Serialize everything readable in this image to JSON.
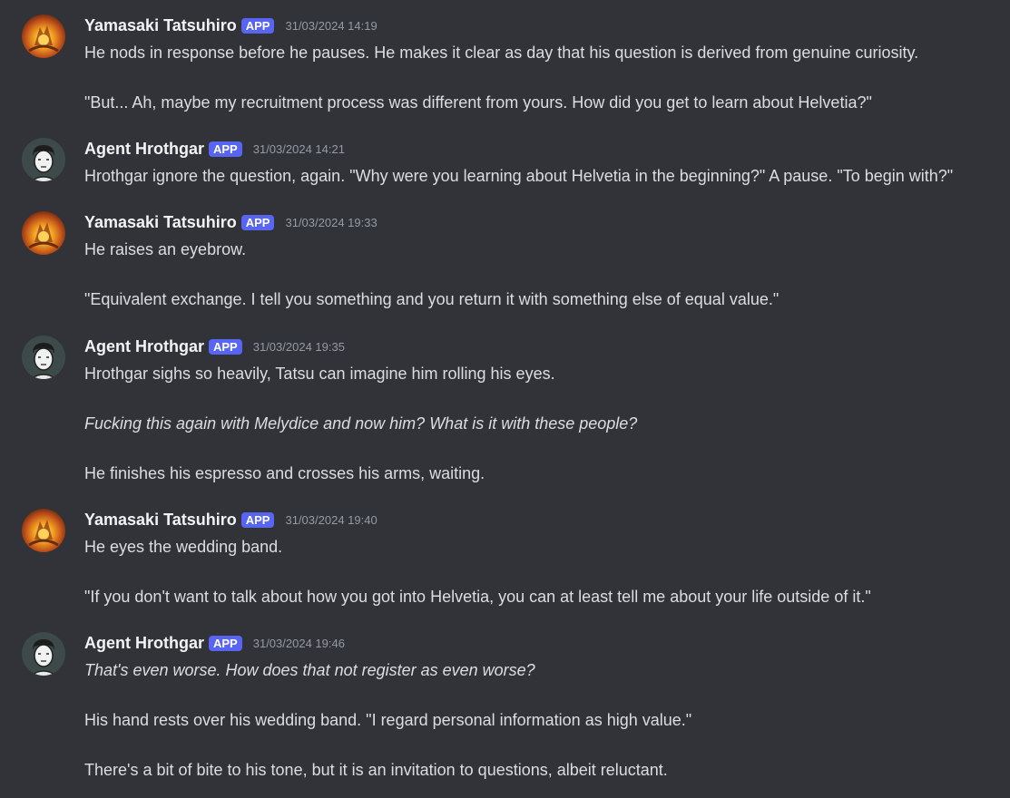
{
  "badge_label": "APP",
  "colors": {
    "background": "#313338",
    "text": "#dbdee1",
    "author": "#f2f3f5",
    "badge": "#5865f2",
    "timestamp": "#949ba4"
  },
  "messages": [
    {
      "author": "Yamasaki Tatsuhiro",
      "avatar": "fiery-dragon-avatar",
      "timestamp": "31/03/2024 14:19",
      "lines": [
        "He nods in response before he pauses. He makes it clear as day that his question is derived from genuine curiosity.",
        "\"But... Ah, maybe my recruitment process was different from yours. How did you get to learn about Helvetia?\""
      ]
    },
    {
      "author": "Agent Hrothgar",
      "avatar": "sketched-man-avatar",
      "timestamp": "31/03/2024 14:21",
      "lines": [
        "Hrothgar ignore the question, again. \"Why were you learning about Helvetia in the beginning?\" A pause. \"To begin with?\""
      ]
    },
    {
      "author": "Yamasaki Tatsuhiro",
      "avatar": "fiery-dragon-avatar",
      "timestamp": "31/03/2024 19:33",
      "lines": [
        "He raises an eyebrow.",
        "\"Equivalent exchange. I tell you something and you return it with something else of equal value.\""
      ]
    },
    {
      "author": "Agent Hrothgar",
      "avatar": "sketched-man-avatar",
      "timestamp": "31/03/2024 19:35",
      "lines": [
        "Hrothgar sighs so heavily, Tatsu can imagine him rolling his eyes.",
        "Fucking this again with Melydice and now him? What is it with these people?",
        "He finishes his espresso and crosses his arms, waiting."
      ]
    },
    {
      "author": "Yamasaki Tatsuhiro",
      "avatar": "fiery-dragon-avatar",
      "timestamp": "31/03/2024 19:40",
      "lines": [
        "He eyes the wedding band.",
        "\"If you don't want to talk about how you got into Helvetia, you can at least tell me about your life outside of it.\""
      ]
    },
    {
      "author": "Agent Hrothgar",
      "avatar": "sketched-man-avatar",
      "timestamp": "31/03/2024 19:46",
      "lines": [
        "That's even worse. How does that not register as even worse?",
        "His hand rests over his wedding band. \"I regard personal information as high value.\"",
        "There's a bit of bite to his tone, but it is an invitation to questions, albeit reluctant."
      ]
    }
  ]
}
